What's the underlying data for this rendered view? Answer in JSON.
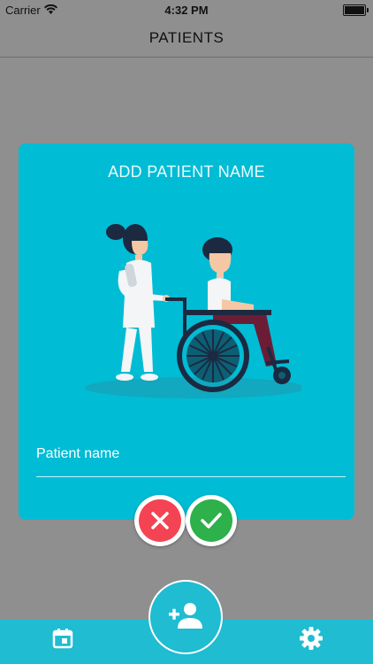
{
  "status_bar": {
    "carrier": "Carrier",
    "time": "4:32 PM"
  },
  "nav": {
    "title": "PATIENTS"
  },
  "dialog": {
    "title": "ADD PATIENT NAME",
    "field_label": "Patient name",
    "illustration": "nurse-pushing-wheelchair-illustration"
  },
  "actions": {
    "cancel_icon": "close-icon",
    "confirm_icon": "check-icon"
  },
  "tab_bar": {
    "left_icon": "calendar-icon",
    "center_icon": "add-person-icon",
    "right_icon": "gear-icon"
  },
  "colors": {
    "accent": "#00bcd4",
    "background_dim": "#8f8f8f",
    "cancel": "#f44352",
    "confirm": "#2eb04a"
  }
}
